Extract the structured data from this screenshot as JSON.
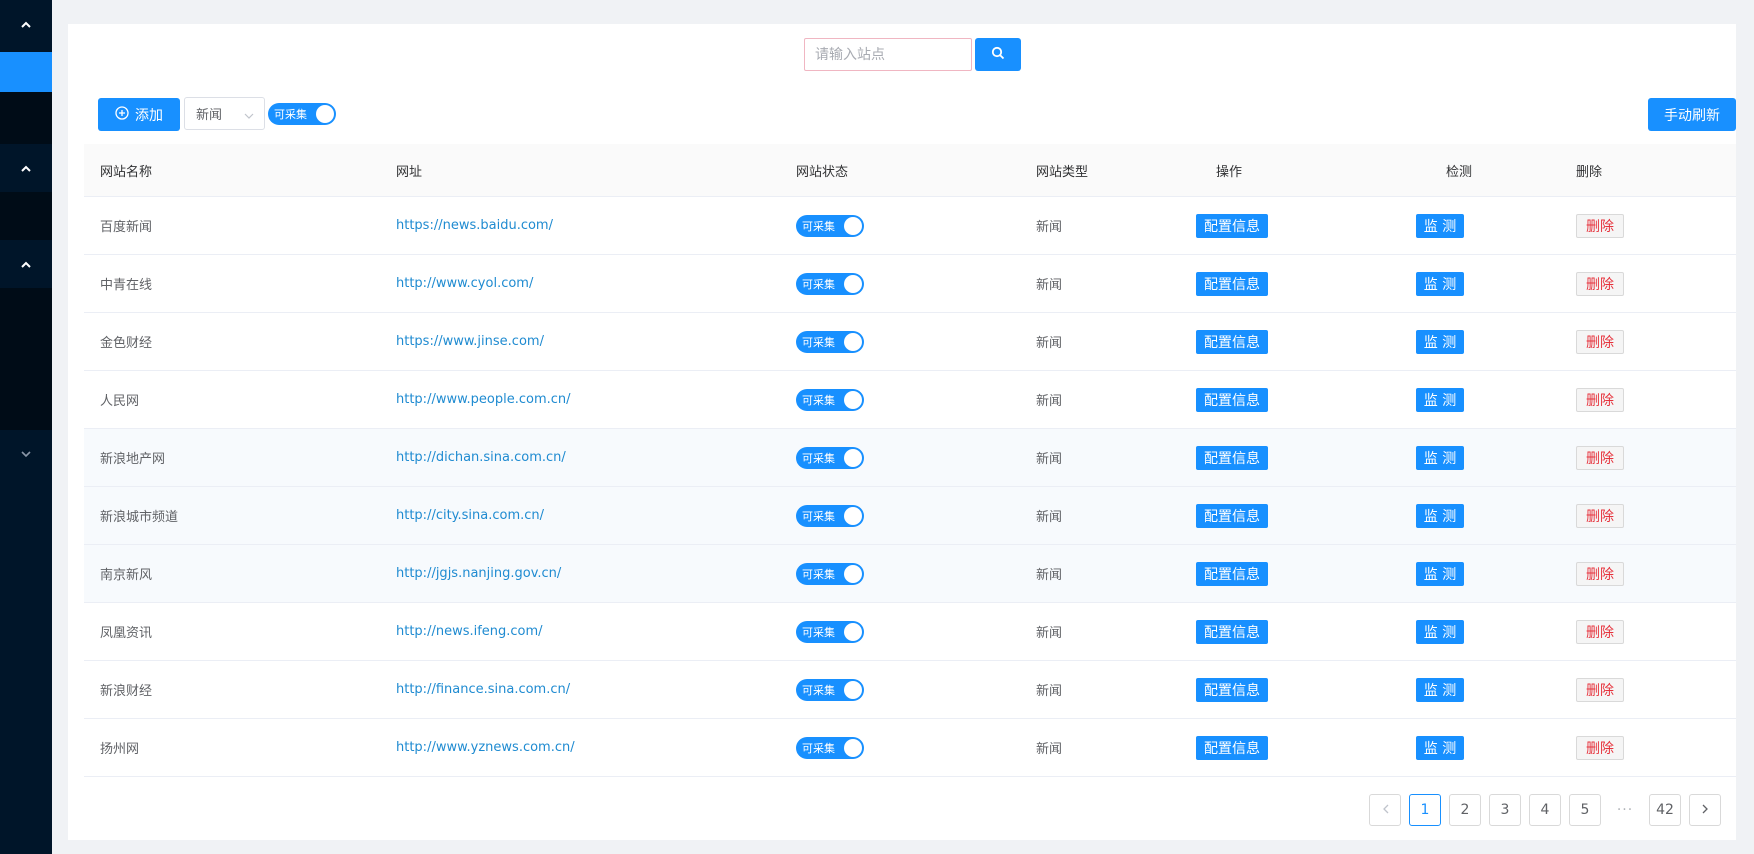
{
  "search": {
    "placeholder": "请输入站点",
    "button_icon": "search-icon"
  },
  "toolbar": {
    "add_label": "添加",
    "add_icon": "plus-circle-icon",
    "type_select_value": "新闻",
    "collect_switch_label": "可采集",
    "refresh_label": "手动刷新"
  },
  "table": {
    "headers": {
      "name": "网站名称",
      "url": "网址",
      "status": "网站状态",
      "type": "网站类型",
      "ops": "操作",
      "detect": "检测",
      "delete": "删除"
    },
    "rows": [
      {
        "name": "百度新闻",
        "url": "https://news.baidu.com/",
        "status": "可采集",
        "type": "新闻",
        "cfg": "配置信息",
        "mon": "监 测",
        "del": "删除"
      },
      {
        "name": "中青在线",
        "url": "http://www.cyol.com/",
        "status": "可采集",
        "type": "新闻",
        "cfg": "配置信息",
        "mon": "监 测",
        "del": "删除"
      },
      {
        "name": "金色财经",
        "url": "https://www.jinse.com/",
        "status": "可采集",
        "type": "新闻",
        "cfg": "配置信息",
        "mon": "监 测",
        "del": "删除"
      },
      {
        "name": "人民网",
        "url": "http://www.people.com.cn/",
        "status": "可采集",
        "type": "新闻",
        "cfg": "配置信息",
        "mon": "监 测",
        "del": "删除"
      },
      {
        "name": "新浪地产网",
        "url": "http://dichan.sina.com.cn/",
        "status": "可采集",
        "type": "新闻",
        "cfg": "配置信息",
        "mon": "监 测",
        "del": "删除"
      },
      {
        "name": "新浪城市频道",
        "url": "http://city.sina.com.cn/",
        "status": "可采集",
        "type": "新闻",
        "cfg": "配置信息",
        "mon": "监 测",
        "del": "删除"
      },
      {
        "name": "南京新风",
        "url": "http://jgjs.nanjing.gov.cn/",
        "status": "可采集",
        "type": "新闻",
        "cfg": "配置信息",
        "mon": "监 测",
        "del": "删除"
      },
      {
        "name": "凤凰资讯",
        "url": "http://news.ifeng.com/",
        "status": "可采集",
        "type": "新闻",
        "cfg": "配置信息",
        "mon": "监 测",
        "del": "删除"
      },
      {
        "name": "新浪财经",
        "url": "http://finance.sina.com.cn/",
        "status": "可采集",
        "type": "新闻",
        "cfg": "配置信息",
        "mon": "监 测",
        "del": "删除"
      },
      {
        "name": "扬州网",
        "url": "http://www.yznews.com.cn/",
        "status": "可采集",
        "type": "新闻",
        "cfg": "配置信息",
        "mon": "监 测",
        "del": "删除"
      }
    ]
  },
  "pagination": {
    "pages": [
      "1",
      "2",
      "3",
      "4",
      "5"
    ],
    "ellipsis": "···",
    "last": "42",
    "current": "1"
  },
  "colors": {
    "primary": "#1890ff",
    "sidebar": "#001529",
    "danger": "#e6323c",
    "link": "#1f8bd1"
  }
}
